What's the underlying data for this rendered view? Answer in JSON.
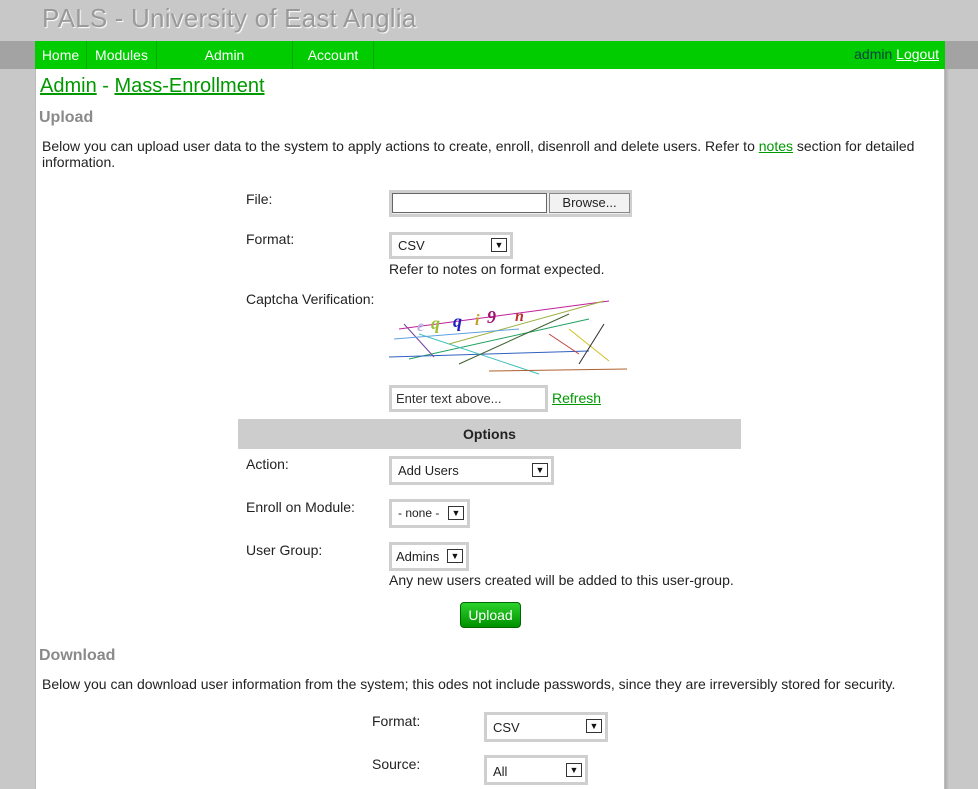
{
  "site": {
    "title": "PALS - University of East Anglia"
  },
  "nav": {
    "items": [
      {
        "label": "Home"
      },
      {
        "label": "Modules"
      },
      {
        "label": "Admin"
      },
      {
        "label": "Account"
      }
    ],
    "username": "admin",
    "logout": "Logout"
  },
  "breadcrumb": {
    "root": "Admin",
    "sep": " - ",
    "current": "Mass-Enrollment"
  },
  "upload": {
    "heading": "Upload",
    "desc_pre": "Below you can upload user data to the system to apply actions to create, enroll, disenroll and delete users. Refer to ",
    "desc_link": "notes",
    "desc_post": " section for detailed information.",
    "file_label": "File:",
    "browse": "Browse...",
    "format_label": "Format:",
    "format_value": "CSV",
    "format_hint": "Refer to notes on format expected.",
    "captcha_label": "Captcha Verification:",
    "captcha_chars": [
      "e",
      "q",
      "q",
      "i",
      "9",
      "n"
    ],
    "captcha_colors": [
      "#b9b0e0",
      "#9ac030",
      "#2020c0",
      "#c0a020",
      "#a01070",
      "#c03030"
    ],
    "captcha_placeholder": "Enter text above...",
    "refresh": "Refresh"
  },
  "options": {
    "heading": "Options",
    "action_label": "Action:",
    "action_value": "Add Users",
    "module_label": "Enroll on Module:",
    "module_value": "- none -",
    "group_label": "User Group:",
    "group_value": "Admins",
    "group_hint": "Any new users created will be added to this user-group.",
    "submit": "Upload"
  },
  "download": {
    "heading": "Download",
    "desc": "Below you can download user information from the system; this odes not include passwords, since they are irreversibly stored for security.",
    "format_label": "Format:",
    "format_value": "CSV",
    "source_label": "Source:",
    "source_value": "All"
  },
  "colors": {
    "accent": "#00cc00",
    "link": "#009900",
    "heading": "#8a8a8a"
  }
}
